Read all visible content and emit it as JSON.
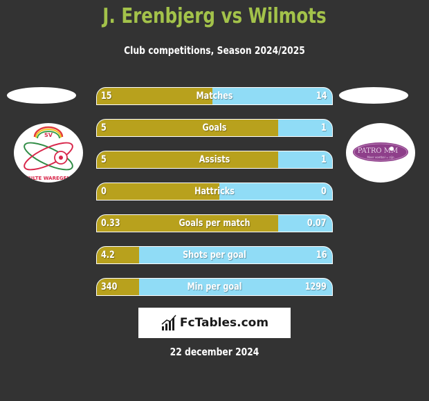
{
  "header": {
    "title": "J. Erenbjerg vs Wilmots",
    "subtitle": "Club competitions, Season 2024/2025"
  },
  "colors": {
    "background": "#333333",
    "title": "#a3c24a",
    "left_bar": "#b8a11d",
    "right_bar": "#90dcf6"
  },
  "players": {
    "left": {
      "name": "J. Erenbjerg",
      "club_logo": "sv-zulte-waregem-logo",
      "logo_text_top": "SV",
      "logo_text_bottom": "ZULTE WAREGEM"
    },
    "right": {
      "name": "Wilmots",
      "club_logo": "patro-maasmechelen-logo",
      "logo_text": "PATRO MM",
      "logo_tagline": "Meer voetbal = zijn"
    }
  },
  "stats": [
    {
      "label": "Matches",
      "left": "15",
      "right": "14",
      "left_share": 0.49
    },
    {
      "label": "Goals",
      "left": "5",
      "right": "1",
      "left_share": 0.77
    },
    {
      "label": "Assists",
      "left": "5",
      "right": "1",
      "left_share": 0.77
    },
    {
      "label": "Hattricks",
      "left": "0",
      "right": "0",
      "left_share": 0.52
    },
    {
      "label": "Goals per match",
      "left": "0.33",
      "right": "0.07",
      "left_share": 0.77
    },
    {
      "label": "Shots per goal",
      "left": "4.2",
      "right": "16",
      "left_share": 0.18
    },
    {
      "label": "Min per goal",
      "left": "340",
      "right": "1299",
      "left_share": 0.18
    }
  ],
  "footer": {
    "brand": "FcTables.com",
    "brand_icon": "bar-chart-icon",
    "date": "22 december 2024"
  }
}
